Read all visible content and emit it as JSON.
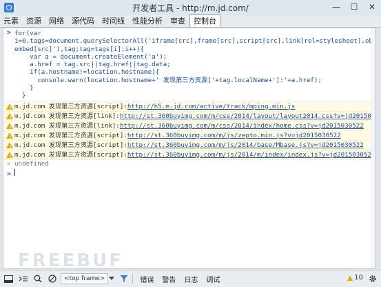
{
  "window": {
    "title": "开发者工具 - http://m.jd.com/",
    "min_glyph": "—",
    "max_glyph": "☐",
    "close_glyph": "✕"
  },
  "tabs": [
    {
      "label": "元素"
    },
    {
      "label": "资源"
    },
    {
      "label": "网络"
    },
    {
      "label": "源代码"
    },
    {
      "label": "时间线"
    },
    {
      "label": "性能分析"
    },
    {
      "label": "审查"
    },
    {
      "label": "控制台"
    }
  ],
  "console": {
    "prompt": ">",
    "input_lines": [
      "for(var",
      "i=0,tags=document.querySelectorAll('iframe[src],frame[src],script[src],link[rel=stylesheet],object[data],",
      "embed[src]'),tag;tag=tags[i];i++){",
      "    var a = document.createElement('a');",
      "    a.href = tag.src||tag.href||tag.data;",
      "    if(a.hostname!=location.hostname){",
      "      console.warn(location.hostname+' 发现第三方资源['+tag.localName+']:'+a.href);",
      "    }",
      "  }"
    ],
    "warnings": [
      {
        "prefix": "m.jd.com 发现第三方资源[script]:",
        "url": "http://h5.m.jd.com/active/track/mping.min.js"
      },
      {
        "prefix": "m.jd.com 发现第三方资源[link]:",
        "url": "http://st.360buyimg.com/m/css/2014/layout/layout2014.css?v=jd2015030522"
      },
      {
        "prefix": "m.jd.com 发现第三方资源[link]:",
        "url": "http://st.360buyimg.com/m/css/2014/index/home.css?v=jd2015030522"
      },
      {
        "prefix": "m.jd.com 发现第三方资源[script]:",
        "url": "http://st.360buyimg.com/m/js/zepto.min.js?v=jd2015030522"
      },
      {
        "prefix": "m.jd.com 发现第三方资源[script]:",
        "url": "http://st.360buyimg.com/m/js/2014/base/Mbase.js?v=jd2015030522"
      },
      {
        "prefix": "m.jd.com 发现第三方资源[script]:",
        "url": "http://st.360buyimg.com/m/js/2014/m/index/index.js?v=jd2015030522"
      }
    ],
    "result_arrow": "<",
    "result": "undefined"
  },
  "toolbar": {
    "frame_select": "<top frame>",
    "filters": [
      "错误",
      "警告",
      "日志",
      "调试"
    ],
    "warning_count": "10"
  },
  "watermark": "FREEBUF",
  "colors": {
    "accent": "#3a7dd8",
    "warning_bg": "#fffbe6",
    "link": "#1a4fa8"
  }
}
